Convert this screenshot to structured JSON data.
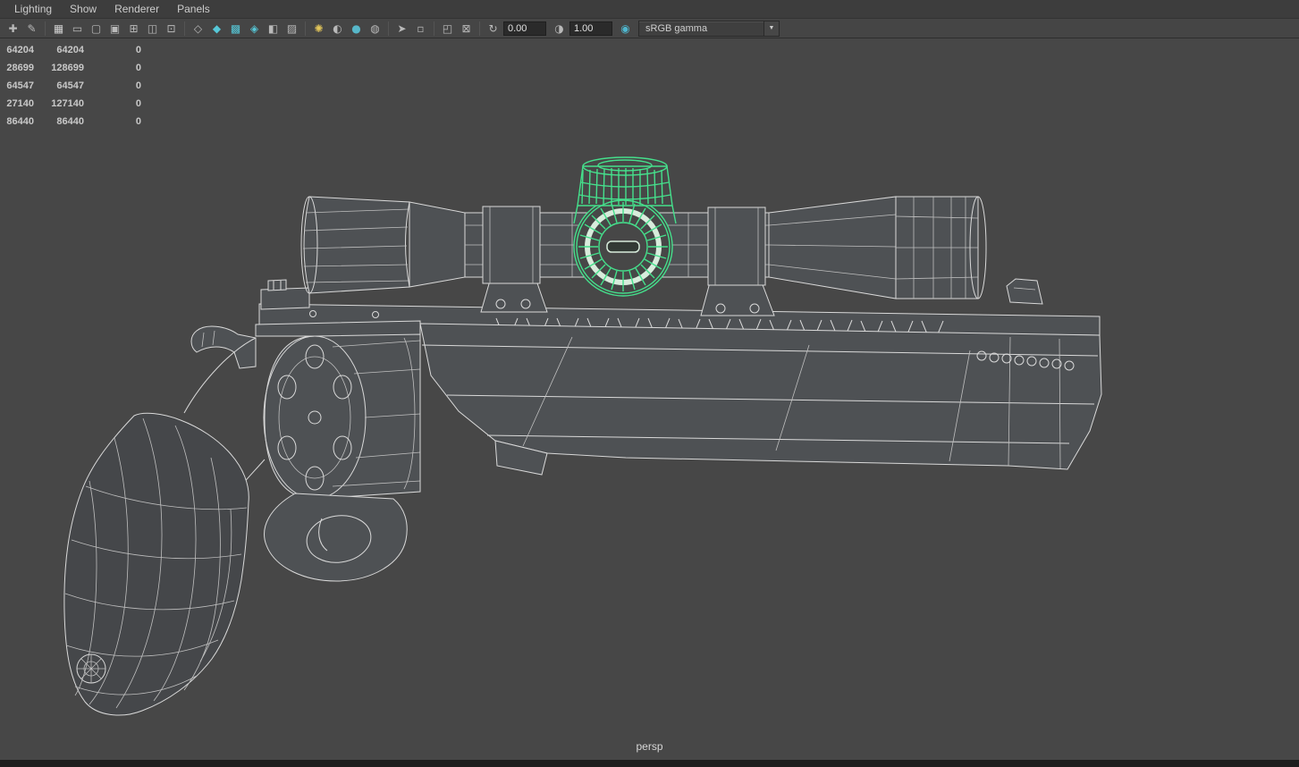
{
  "menu_bar": {
    "items": [
      {
        "label": "Lighting"
      },
      {
        "label": "Show"
      },
      {
        "label": "Renderer"
      },
      {
        "label": "Panels"
      }
    ]
  },
  "toolbar": {
    "icons": [
      {
        "name": "select-camera",
        "glyph": "✚",
        "color": "#b9b9b9"
      },
      {
        "name": "grease-pencil",
        "glyph": "✎",
        "color": "#b9b9b9"
      },
      {
        "name": "grid",
        "glyph": "▦",
        "color": "#cfcfcf"
      },
      {
        "name": "film-gate",
        "glyph": "▭",
        "color": "#b9b9b9"
      },
      {
        "name": "resolution-gate",
        "glyph": "▢",
        "color": "#b9b9b9"
      },
      {
        "name": "gate-mask",
        "glyph": "▣",
        "color": "#b9b9b9"
      },
      {
        "name": "field-chart",
        "glyph": "⊞",
        "color": "#b9b9b9"
      },
      {
        "name": "safe-action",
        "glyph": "◫",
        "color": "#b9b9b9"
      },
      {
        "name": "safe-title",
        "glyph": "⊡",
        "color": "#b9b9b9"
      },
      {
        "name": "wireframe",
        "glyph": "◇",
        "color": "#b9b9b9"
      },
      {
        "name": "smooth-shade-all",
        "glyph": "◆",
        "color": "#56c8d8"
      },
      {
        "name": "textured",
        "glyph": "▩",
        "color": "#56c8d8"
      },
      {
        "name": "wireframe-on-shaded",
        "glyph": "◈",
        "color": "#56c8d8"
      },
      {
        "name": "use-default-material",
        "glyph": "◧",
        "color": "#b9b9b9"
      },
      {
        "name": "xray",
        "glyph": "▨",
        "color": "#b9b9b9"
      },
      {
        "name": "use-all-lights",
        "glyph": "✺",
        "color": "#e3c65a"
      },
      {
        "name": "shadows",
        "glyph": "◐",
        "color": "#b9b9b9"
      },
      {
        "name": "screen-space-ao",
        "glyph": "●",
        "color": "#57b7c9"
      },
      {
        "name": "motion-blur",
        "glyph": "◍",
        "color": "#b9b9b9"
      },
      {
        "name": "select-tool",
        "glyph": "➤",
        "color": "#b9b9b9"
      },
      {
        "name": "lasso-select",
        "glyph": "▫",
        "color": "#b9b9b9"
      },
      {
        "name": "isolate-select",
        "glyph": "◰",
        "color": "#b9b9b9"
      },
      {
        "name": "frame-selection",
        "glyph": "⊠",
        "color": "#b9b9b9"
      }
    ],
    "exposure": {
      "icon": "↻",
      "value": "0.00"
    },
    "gamma": {
      "icon": "◑",
      "value": "1.00"
    },
    "color_management": {
      "icon": "◉",
      "color": "#4fb7cf"
    },
    "view_transform": {
      "value": "sRGB gamma",
      "chevron": "▼"
    }
  },
  "hud": {
    "rows": [
      [
        "64204",
        "64204",
        "0"
      ],
      [
        "28699",
        "128699",
        "0"
      ],
      [
        "64547",
        "64547",
        "0"
      ],
      [
        "27140",
        "127140",
        "0"
      ],
      [
        "86440",
        "86440",
        "0"
      ]
    ]
  },
  "viewport": {
    "camera_label": "persp",
    "background": "#474747",
    "selection_color": "#45e08c",
    "wireframe_color": "#d9d9d9"
  }
}
